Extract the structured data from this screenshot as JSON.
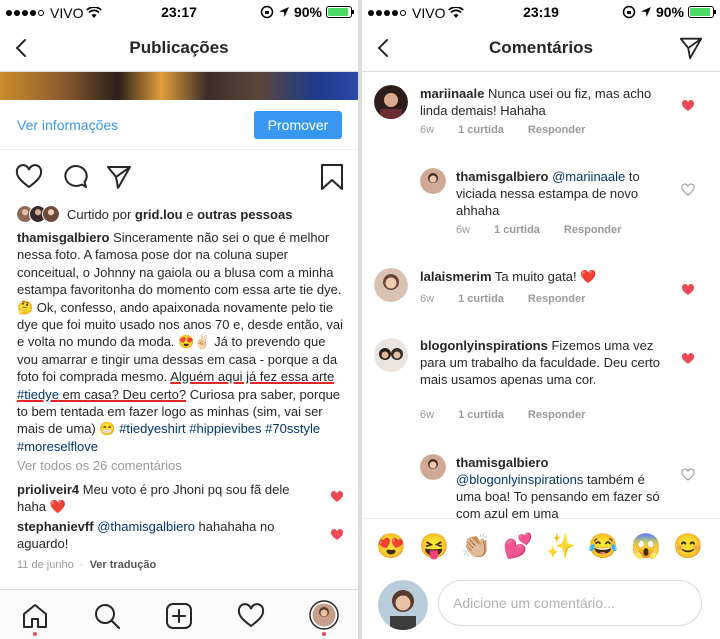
{
  "left": {
    "status": {
      "carrier": "VIVO",
      "time": "23:17",
      "battery": "90%"
    },
    "nav_title": "Publicações",
    "info_link": "Ver informações",
    "promote_label": "Promover",
    "likes": {
      "prefix": "Curtido por ",
      "user": "grid.lou",
      "mid": " e ",
      "others": "outras pessoas"
    },
    "caption": {
      "user": "thamisgalbiero",
      "text1": " Sinceramente não sei o que é melhor nessa foto. A famosa pose dor na coluna super conceitual, o Johnny na gaiola ou a blusa com a minha estampa favoritonha do momento com essa arte tie dye. 🤔 Ok, confesso, ando apaixonada novamente pelo tie dye que foi muito usado nos anos 70 e, desde então, vai e volta no mundo da moda. 😍✌🏻 Já to prevendo que vou amarrar e tingir uma dessas em casa - porque a da foto foi comprada mesmo. ",
      "underline1": "Alguém aqui já fez essa arte ",
      "underline_tag": "#tiedye",
      "underline2": " em casa? Deu certo?",
      "text2": " Curiosa pra saber, porque to bem tentada em fazer logo as minhas (sim, vai ser mais de uma) 😁 ",
      "hashtags": "#tiedyeshirt #hippievibes #70sstyle #moreselflove"
    },
    "view_all": "Ver todos os 26 comentários",
    "comments": [
      {
        "user": "prioliveir4",
        "text": " Meu voto é pro Jhoni pq sou fã dele haha ❤️"
      },
      {
        "user": "stephanievff",
        "mention": " @thamisgalbiero",
        "text": " hahahaha no aguardo!"
      }
    ],
    "meta": {
      "date": "11 de junho",
      "translate": "Ver tradução"
    }
  },
  "right": {
    "status": {
      "carrier": "VIVO",
      "time": "23:19",
      "battery": "90%"
    },
    "nav_title": "Comentários",
    "comments": [
      {
        "user": "mariinaale",
        "text": " Nunca usei ou fiz, mas acho linda demais! Hahaha",
        "time": "6w",
        "likes": "1 curtida",
        "reply": "Responder"
      },
      {
        "user": "thamisgalbiero",
        "mention": " @mariinaale",
        "text": " to viciada nessa estampa de novo ahhaha",
        "time": "6w",
        "likes": "1 curtida",
        "reply": "Responder"
      },
      {
        "user": "lalaismerim",
        "text": " Ta muito gata! ❤️",
        "time": "6w",
        "likes": "1 curtida",
        "reply": "Responder"
      },
      {
        "user": "blogonlyinspirations",
        "text": " Fizemos uma vez para um trabalho da faculdade. Deu certo mais usamos apenas uma cor.",
        "time": "6w",
        "likes": "1 curtida",
        "reply": "Responder"
      },
      {
        "user": "thamisgalbiero",
        "mention": " @blogonlyinspirations",
        "text": " também é uma boa! To pensando em fazer só com azul em uma"
      }
    ],
    "emojis": [
      "😍",
      "😝",
      "👏🏼",
      "💕",
      "✨",
      "😂",
      "😱",
      "😊"
    ],
    "input_placeholder": "Adicione um comentário..."
  },
  "colors": {
    "link": "#3897f0",
    "heart": "#ed4956",
    "hashtag": "#003569"
  }
}
